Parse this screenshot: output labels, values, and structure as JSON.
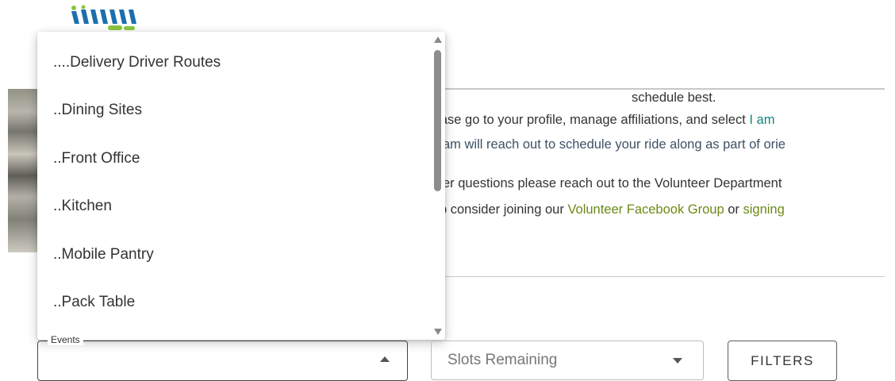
{
  "intro": {
    "line1": "schedule best.",
    "line2_prefix": "lease go to your profile, manage affiliations, and select ",
    "line2_link": "I am",
    "line3": "am will reach out to schedule your ride along as part of orie",
    "line4": "er questions please reach out to the Volunteer Department",
    "line5_prefix": "p consider joining our ",
    "line5_link1": "Volunteer Facebook Group",
    "line5_mid": " or ",
    "line5_link2": "signing"
  },
  "dropdown": {
    "items": [
      {
        "label": "....Delivery Driver Routes"
      },
      {
        "label": "..Dining Sites"
      },
      {
        "label": "..Front Office"
      },
      {
        "label": "..Kitchen"
      },
      {
        "label": "..Mobile Pantry"
      },
      {
        "label": "..Pack Table"
      }
    ]
  },
  "filters": {
    "events_label": "Events",
    "slots_placeholder": "Slots Remaining",
    "filters_button": "FILTERS"
  },
  "colors": {
    "link_teal": "#12867d",
    "link_green": "#6a8a15",
    "logo_blue": "#1c6fae",
    "logo_green": "#8bc63e"
  }
}
